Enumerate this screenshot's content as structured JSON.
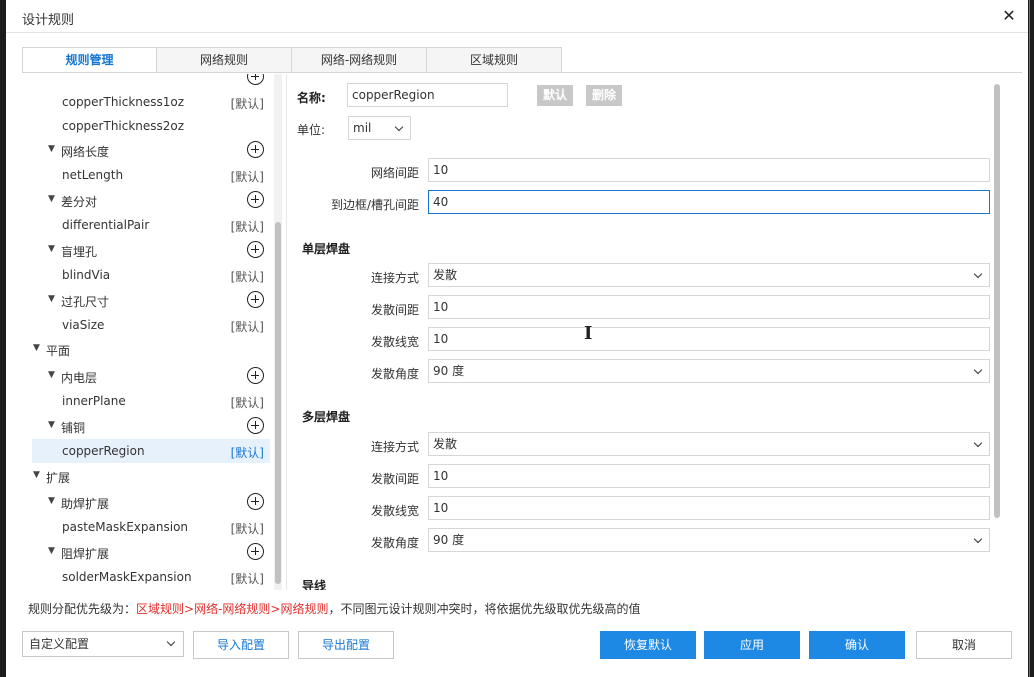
{
  "window": {
    "title": "设计规则",
    "close_glyph": "✕"
  },
  "tabs": [
    {
      "label": "规则管理",
      "active": true
    },
    {
      "label": "网络规则",
      "active": false
    },
    {
      "label": "网络-网络规则",
      "active": false
    },
    {
      "label": "区域规则",
      "active": false
    }
  ],
  "tree": {
    "rows": [
      {
        "type": "leaf",
        "label": "copperThickness1oz",
        "tag": "[默认]"
      },
      {
        "type": "leaf",
        "label": "copperThickness2oz",
        "tag": ""
      },
      {
        "type": "group",
        "label": "网络长度",
        "add": true
      },
      {
        "type": "leaf",
        "label": "netLength",
        "tag": "[默认]"
      },
      {
        "type": "group",
        "label": "差分对",
        "add": true
      },
      {
        "type": "leaf",
        "label": "differentialPair",
        "tag": "[默认]"
      },
      {
        "type": "group",
        "label": "盲埋孔",
        "add": true
      },
      {
        "type": "leaf",
        "label": "blindVia",
        "tag": "[默认]"
      },
      {
        "type": "group",
        "label": "过孔尺寸",
        "add": true
      },
      {
        "type": "leaf",
        "label": "viaSize",
        "tag": "[默认]"
      },
      {
        "type": "category",
        "label": "平面"
      },
      {
        "type": "group",
        "label": "内电层",
        "add": true
      },
      {
        "type": "leaf",
        "label": "innerPlane",
        "tag": "[默认]"
      },
      {
        "type": "group",
        "label": "铺铜",
        "add": true
      },
      {
        "type": "leaf",
        "label": "copperRegion",
        "tag": "[默认]",
        "selected": true
      },
      {
        "type": "category",
        "label": "扩展"
      },
      {
        "type": "group",
        "label": "助焊扩展",
        "add": true
      },
      {
        "type": "leaf",
        "label": "pasteMaskExpansion",
        "tag": "[默认]"
      },
      {
        "type": "group",
        "label": "阻焊扩展",
        "add": true
      },
      {
        "type": "leaf",
        "label": "solderMaskExpansion",
        "tag": "[默认]"
      }
    ]
  },
  "form": {
    "name_label": "名称:",
    "name_value": "copperRegion",
    "default_btn": "默认",
    "delete_btn": "删除",
    "unit_label": "单位:",
    "unit_value": "mil",
    "net_spacing_label": "网络间距",
    "net_spacing_value": "10",
    "board_spacing_label": "到边框/槽孔间距",
    "board_spacing_value": "40",
    "single_layer_pad": {
      "heading": "单层焊盘",
      "connect_label": "连接方式",
      "connect_value": "发散",
      "spoke_spacing_label": "发散间距",
      "spoke_spacing_value": "10",
      "spoke_width_label": "发散线宽",
      "spoke_width_value": "10",
      "spoke_angle_label": "发散角度",
      "spoke_angle_value": "90 度"
    },
    "multi_layer_pad": {
      "heading": "多层焊盘",
      "connect_label": "连接方式",
      "connect_value": "发散",
      "spoke_spacing_label": "发散间距",
      "spoke_spacing_value": "10",
      "spoke_width_label": "发散线宽",
      "spoke_width_value": "10",
      "spoke_angle_label": "发散角度",
      "spoke_angle_value": "90 度"
    },
    "track_heading": "导线"
  },
  "footnote": {
    "prefix": "规则分配优先级为：",
    "priority": "区域规则>网络-网络规则>网络规则",
    "suffix": "，不同图元设计规则冲突时，将依据优先级取优先级高的值"
  },
  "footer": {
    "config_select": "自定义配置",
    "import_btn": "导入配置",
    "export_btn": "导出配置",
    "restore_btn": "恢复默认",
    "apply_btn": "应用",
    "confirm_btn": "确认",
    "cancel_btn": "取消"
  },
  "colors": {
    "accent": "#1677d2",
    "primary_button": "#1e88e5",
    "priority_text": "#e0302c"
  }
}
